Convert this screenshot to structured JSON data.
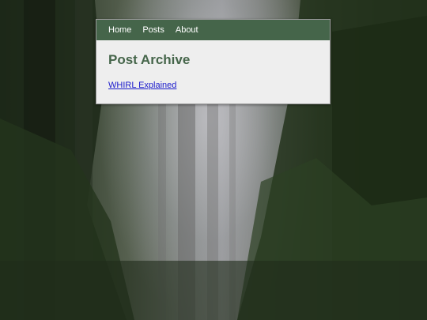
{
  "nav": {
    "items": [
      {
        "label": "Home"
      },
      {
        "label": "Posts"
      },
      {
        "label": "About"
      }
    ]
  },
  "main": {
    "title": "Post Archive",
    "posts": [
      {
        "label": "WHIRL Explained"
      }
    ]
  },
  "colors": {
    "nav_background": "#45654a",
    "title": "#45654a",
    "card_background": "#eeeeee",
    "link": "#1a1acc"
  }
}
